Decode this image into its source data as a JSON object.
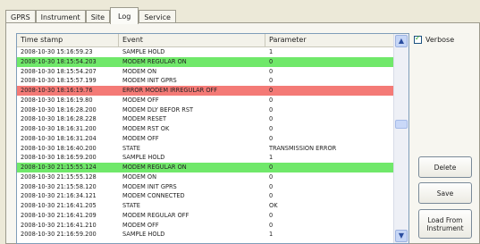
{
  "tabs": [
    "GPRS",
    "Instrument",
    "Site",
    "Log",
    "Service"
  ],
  "log_table": {
    "columns": [
      "Time stamp",
      "Event",
      "Parameter"
    ],
    "rows": [
      {
        "time": "2008-10-30 15:16:59.23",
        "event": "SAMPLE HOLD",
        "param": "1",
        "highlight": ""
      },
      {
        "time": "2008-10-30 18:15:54.203",
        "event": "MODEM REGULAR ON",
        "param": "0",
        "highlight": "green"
      },
      {
        "time": "2008-10-30 18:15:54.207",
        "event": "MODEM ON",
        "param": "0",
        "highlight": ""
      },
      {
        "time": "2008-10-30 18:15:57.199",
        "event": "MODEM INIT GPRS",
        "param": "0",
        "highlight": ""
      },
      {
        "time": "2008-10-30 18:16:19.76",
        "event": "ERROR MODEM IRREGULAR OFF",
        "param": "0",
        "highlight": "red"
      },
      {
        "time": "2008-10-30 18:16:19.80",
        "event": "MODEM OFF",
        "param": "0",
        "highlight": ""
      },
      {
        "time": "2008-10-30 18:16:28.200",
        "event": "MODEM DLY BEFOR RST",
        "param": "0",
        "highlight": ""
      },
      {
        "time": "2008-10-30 18:16:28.228",
        "event": "MODEM RESET",
        "param": "0",
        "highlight": ""
      },
      {
        "time": "2008-10-30 18:16:31.200",
        "event": "MODEM RST OK",
        "param": "0",
        "highlight": ""
      },
      {
        "time": "2008-10-30 18:16:31.204",
        "event": "MODEM OFF",
        "param": "0",
        "highlight": ""
      },
      {
        "time": "2008-10-30 18:16:40.200",
        "event": "STATE",
        "param": "TRANSMISSION ERROR",
        "highlight": ""
      },
      {
        "time": "2008-10-30 18:16:59.200",
        "event": "SAMPLE HOLD",
        "param": "1",
        "highlight": ""
      },
      {
        "time": "2008-10-30 21:15:55.124",
        "event": "MODEM REGULAR ON",
        "param": "0",
        "highlight": "green"
      },
      {
        "time": "2008-10-30 21:15:55.128",
        "event": "MODEM ON",
        "param": "0",
        "highlight": ""
      },
      {
        "time": "2008-10-30 21:15:58.120",
        "event": "MODEM INIT GPRS",
        "param": "0",
        "highlight": ""
      },
      {
        "time": "2008-10-30 21:16:34.121",
        "event": "MODEM CONNECTED",
        "param": "0",
        "highlight": ""
      },
      {
        "time": "2008-10-30 21:16:41.205",
        "event": "STATE",
        "param": "OK",
        "highlight": ""
      },
      {
        "time": "2008-10-30 21:16:41.209",
        "event": "MODEM REGULAR OFF",
        "param": "0",
        "highlight": ""
      },
      {
        "time": "2008-10-30 21:16:41.210",
        "event": "MODEM OFF",
        "param": "0",
        "highlight": ""
      },
      {
        "time": "2008-10-30 21:16:59.200",
        "event": "SAMPLE HOLD",
        "param": "1",
        "highlight": ""
      }
    ]
  },
  "verbose": {
    "label": "Verbose",
    "checked": true
  },
  "buttons": {
    "delete": "Delete",
    "save": "Save",
    "load": "Load From Instrument"
  },
  "colors": {
    "green": "#70e86a",
    "red": "#f47a76",
    "window_bg": "#ece9d8"
  }
}
